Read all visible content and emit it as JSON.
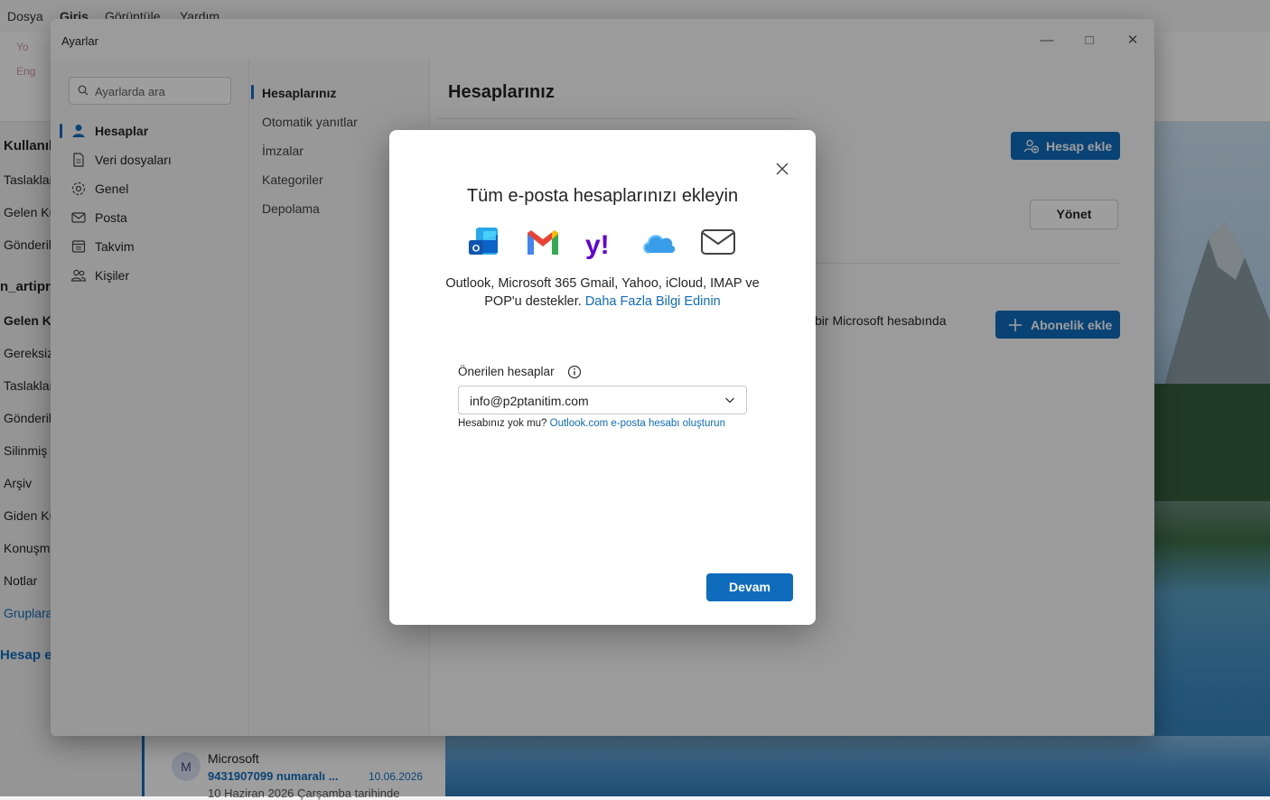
{
  "menubar": {
    "items": [
      "Dosya",
      "Giriş",
      "Görüntüle",
      "Yardım"
    ]
  },
  "ribbon": {
    "items": [
      "Yo",
      "Eng"
    ]
  },
  "leftnav": {
    "header_user": "Kullanıl",
    "items_top": [
      "Taslaklar",
      "Gelen Ku",
      "Gönderil"
    ],
    "account": "n_artipr",
    "folders": [
      "Gelen Ku",
      "Gereksiz",
      "Taslaklar",
      "Gönderil",
      "Silinmiş",
      "Arşiv",
      "Giden Ku",
      "Konuşma",
      "Notlar"
    ],
    "groups": "Gruplara",
    "add_account": "Hesap ek"
  },
  "message": {
    "avatar": "M",
    "sender": "Microsoft",
    "subject": "9431907099 numaralı ...",
    "date": "10.06.2026",
    "preview": "10 Haziran 2026 Çarşamba tarihinde"
  },
  "settings": {
    "title": "Ayarlar",
    "search_placeholder": "Ayarlarda ara",
    "categories": [
      {
        "label": "Hesaplar",
        "icon": "person-icon"
      },
      {
        "label": "Veri dosyaları",
        "icon": "document-icon"
      },
      {
        "label": "Genel",
        "icon": "gear-icon"
      },
      {
        "label": "Posta",
        "icon": "mail-icon"
      },
      {
        "label": "Takvim",
        "icon": "calendar-icon"
      },
      {
        "label": "Kişiler",
        "icon": "people-icon"
      }
    ],
    "subnav": [
      "Hesaplarınız",
      "Otomatik yanıtlar",
      "İmzalar",
      "Kategoriler",
      "Depolama"
    ],
    "heading": "Hesaplarınız",
    "add_account_btn": "Hesap ekle",
    "manage_btn": "Yönet",
    "ms_text": "bir Microsoft hesabında",
    "add_subscription_btn": "Abonelik ekle"
  },
  "dialog": {
    "title": "Tüm e-posta hesaplarınızı ekleyin",
    "providers": [
      "outlook-icon",
      "gmail-icon",
      "yahoo-icon",
      "icloud-icon",
      "mail-envelope-icon"
    ],
    "description": "Outlook, Microsoft 365 Gmail, Yahoo, iCloud, IMAP ve POP'u destekler.",
    "learn_more": "Daha Fazla Bilgi Edinin",
    "suggested_label": "Önerilen hesaplar",
    "selected_account": "info@p2ptanitim.com",
    "no_account_text": "Hesabınız yok mu?",
    "create_link": "Outlook.com e-posta hesabı oluşturun",
    "continue_btn": "Devam"
  },
  "colors": {
    "accent": "#0f6cbd"
  }
}
